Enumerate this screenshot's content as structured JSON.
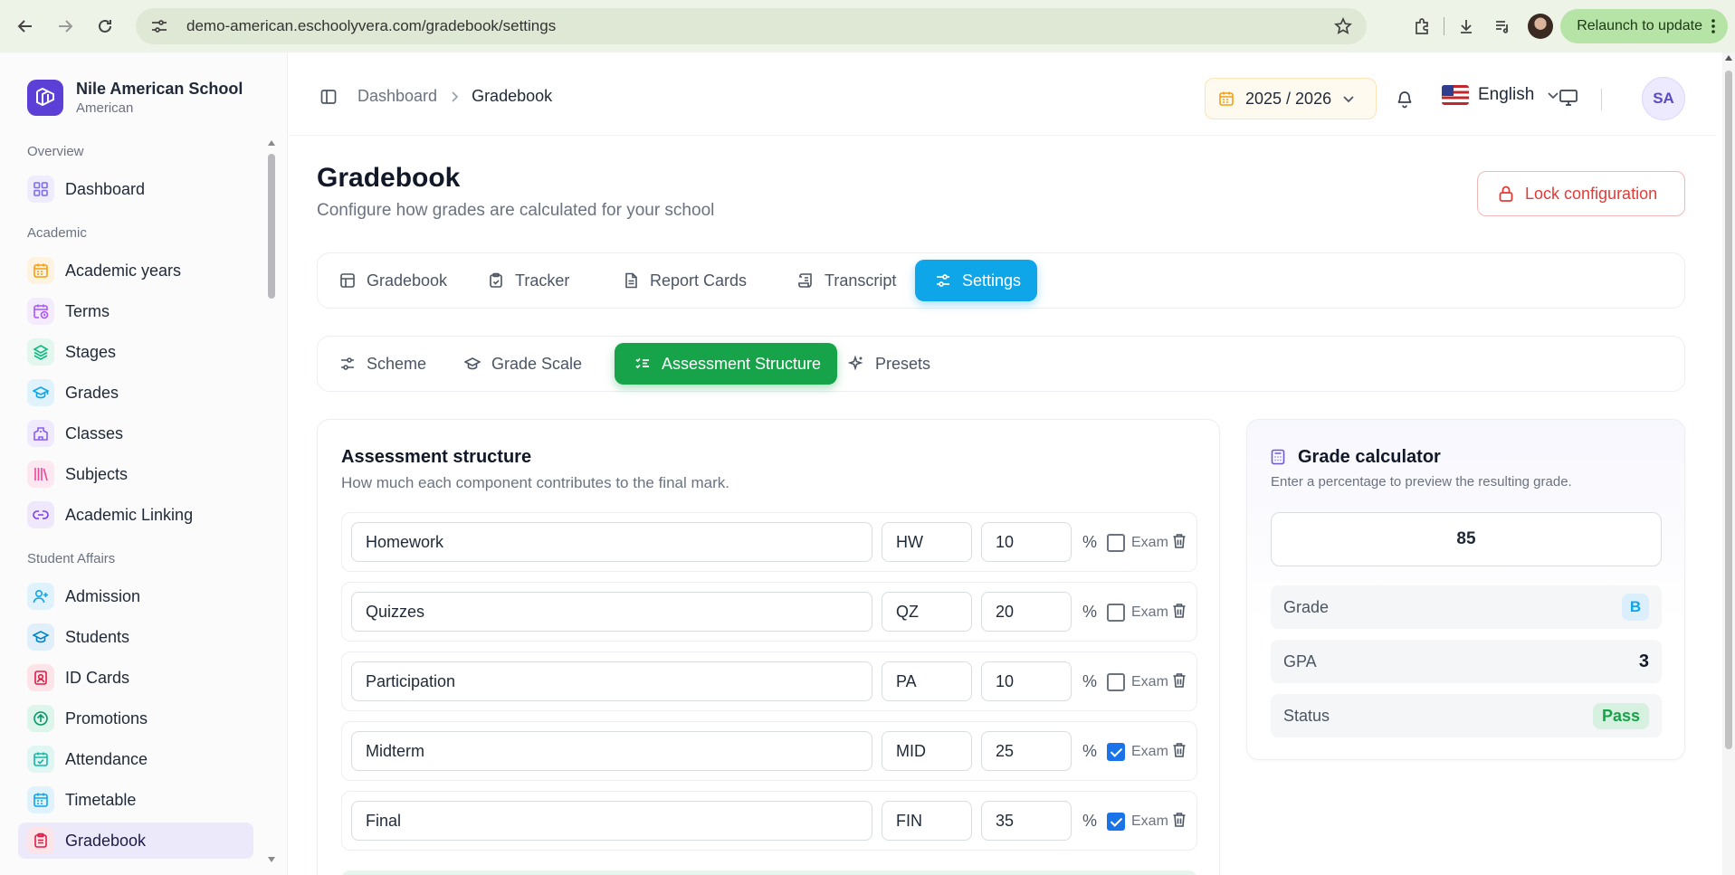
{
  "browser": {
    "url": "demo-american.eschoolyvera.com/gradebook/settings",
    "relaunch_label": "Relaunch to update"
  },
  "school": {
    "name": "Nile American School",
    "type": "American"
  },
  "sidebar": {
    "groups": {
      "overview": "Overview",
      "academic": "Academic",
      "student_affairs": "Student Affairs"
    },
    "items": [
      {
        "label": "Dashboard",
        "icon": "grid-icon",
        "color": "#7c6cf0"
      },
      {
        "label": "Academic years",
        "icon": "calendar-icon",
        "color": "#f59e0b"
      },
      {
        "label": "Terms",
        "icon": "calendar-clock-icon",
        "color": "#a855f7"
      },
      {
        "label": "Stages",
        "icon": "layers-icon",
        "color": "#10b981"
      },
      {
        "label": "Grades",
        "icon": "graduation-cap-icon",
        "color": "#0ea5e9"
      },
      {
        "label": "Classes",
        "icon": "school-icon",
        "color": "#8b5cf6"
      },
      {
        "label": "Subjects",
        "icon": "library-icon",
        "color": "#ec4899"
      },
      {
        "label": "Academic Linking",
        "icon": "link-icon",
        "color": "#7c3aed"
      },
      {
        "label": "Admission",
        "icon": "user-plus-icon",
        "color": "#0ea5e9"
      },
      {
        "label": "Students",
        "icon": "graduation-cap-icon",
        "color": "#0284c7"
      },
      {
        "label": "ID Cards",
        "icon": "id-card-icon",
        "color": "#e11d48"
      },
      {
        "label": "Promotions",
        "icon": "arrow-up-circle-icon",
        "color": "#059669"
      },
      {
        "label": "Attendance",
        "icon": "calendar-check-icon",
        "color": "#14b8a6"
      },
      {
        "label": "Timetable",
        "icon": "calendar-grid-icon",
        "color": "#0ea5e9"
      },
      {
        "label": "Gradebook",
        "icon": "clipboard-icon",
        "color": "#e11d48"
      }
    ]
  },
  "header": {
    "breadcrumb": [
      "Dashboard",
      "Gradebook"
    ],
    "year": "2025 / 2026",
    "language": "English",
    "avatar_initials": "SA"
  },
  "page": {
    "title": "Gradebook",
    "subtitle": "Configure how grades are calculated for your school",
    "lock_label": "Lock configuration"
  },
  "main_tabs": [
    "Gradebook",
    "Tracker",
    "Report Cards",
    "Transcript",
    "Settings"
  ],
  "settings_tabs": [
    "Scheme",
    "Grade Scale",
    "Assessment Structure",
    "Presets"
  ],
  "assessment": {
    "title": "Assessment structure",
    "subtitle": "How much each component contributes to the final mark.",
    "percent_symbol": "%",
    "exam_label": "Exam",
    "components": [
      {
        "name": "Homework",
        "code": "HW",
        "weight": "10",
        "exam": false
      },
      {
        "name": "Quizzes",
        "code": "QZ",
        "weight": "20",
        "exam": false
      },
      {
        "name": "Participation",
        "code": "PA",
        "weight": "10",
        "exam": false
      },
      {
        "name": "Midterm",
        "code": "MID",
        "weight": "25",
        "exam": true
      },
      {
        "name": "Final",
        "code": "FIN",
        "weight": "35",
        "exam": true
      }
    ]
  },
  "calculator": {
    "title": "Grade calculator",
    "subtitle": "Enter a percentage to preview the resulting grade.",
    "input_value": "85",
    "grade_label": "Grade",
    "grade_value": "B",
    "gpa_label": "GPA",
    "gpa_value": "3",
    "status_label": "Status",
    "status_value": "Pass"
  },
  "colors": {
    "brand": "#5b3fd6",
    "settings_tab": "#0ea5e9",
    "assessment_tab": "#16a34a",
    "lock": "#e53935"
  }
}
